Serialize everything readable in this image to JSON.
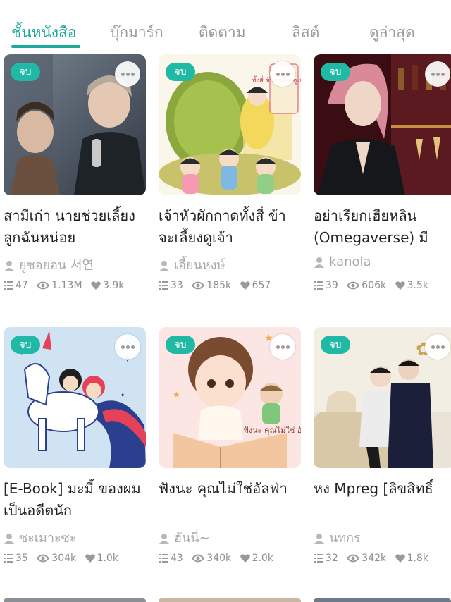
{
  "tabs": [
    {
      "label": "ชั้นหนังสือ",
      "active": true
    },
    {
      "label": "บุ๊กมาร์ก",
      "active": false
    },
    {
      "label": "ติดตาม",
      "active": false
    },
    {
      "label": "ลิสต์",
      "active": false
    },
    {
      "label": "ดูล่าสุด",
      "active": false
    }
  ],
  "books": [
    {
      "badge": "จบ",
      "title": "สามีเก่า นายช่วยเลี้ยงลูกฉันหน่อย",
      "author": "ยูซอยอน 서연",
      "chapters": "47",
      "views": "1.13M",
      "likes": "3.9k"
    },
    {
      "badge": "จบ",
      "title": "เจ้าหัวผักกาดทั้งสี่ ข้าจะเลี้ยงดูเจ้า",
      "author": "เอี้ยนหงษ์",
      "chapters": "33",
      "views": "185k",
      "likes": "657",
      "cover_text": "ทั้งสี่ ข้าจะเลี้ยงดูเจ้าเอง"
    },
    {
      "badge": "จบ",
      "title": "อย่าเรียกเฮียหลิน (Omegaverse) มี",
      "author": "kanola",
      "chapters": "39",
      "views": "606k",
      "likes": "3.5k"
    },
    {
      "badge": "จบ",
      "title": "[E-Book] มะมี้ ของผมเป็นอดีตนัก",
      "author": "ซะเมาะซะ",
      "chapters": "35",
      "views": "304k",
      "likes": "1.0k"
    },
    {
      "badge": "จบ",
      "title": "ฟังนะ คุณไม่ใช่อัลฟ่า",
      "author": "ฮันนี่~",
      "chapters": "43",
      "views": "340k",
      "likes": "2.0k",
      "cover_text": "ฟังนะ คุณไม่ใช่ อัลฟ่า"
    },
    {
      "badge": "จบ",
      "title": "หง Mpreg [ลิขสิทธิ์",
      "author": "นทกร",
      "chapters": "32",
      "views": "342k",
      "likes": "1.8k"
    }
  ],
  "colors": {
    "accent": "#1ba99b",
    "badge": "#1fb9a6",
    "muted": "#9a9a9a"
  },
  "icons": {
    "author": "user-icon",
    "chapters": "list-icon",
    "views": "eye-icon",
    "likes": "heart-icon",
    "more": "more-dots-icon"
  }
}
